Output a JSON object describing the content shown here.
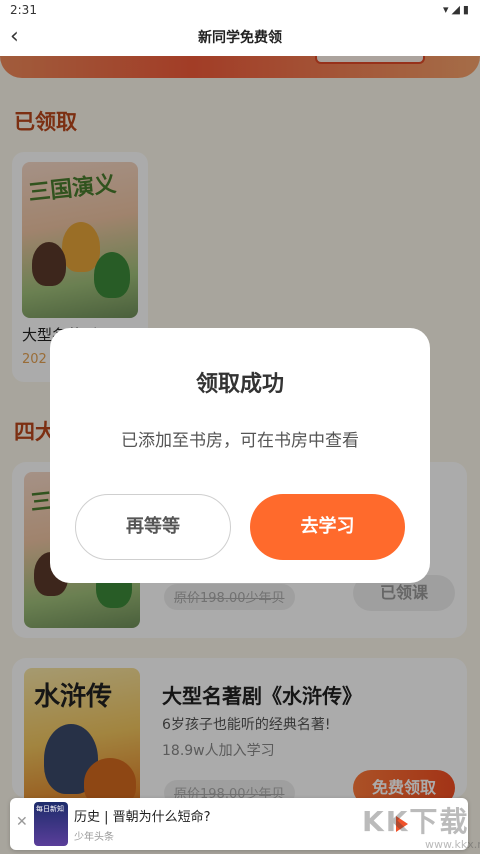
{
  "status_bar": {
    "time": "2:31",
    "icons": "▾◢▮"
  },
  "nav": {
    "back": "‹",
    "title": "新同学免费领"
  },
  "sections": {
    "claimed": "已领取",
    "classics": "四大"
  },
  "claimed_course": {
    "cover_title": "三国演义",
    "name": "大型名著剧",
    "date": "202"
  },
  "courses": [
    {
      "cover_title": "三国演义",
      "price": "原价198.00少年贝",
      "action": "已领课"
    },
    {
      "cover_title": "水浒传",
      "title": "大型名著剧《水浒传》",
      "desc": "6岁孩子也能听的经典名著!",
      "learners": "18.9w人加入学习",
      "price": "原价198.00少年贝",
      "action": "免费领取"
    }
  ],
  "dialog": {
    "title": "领取成功",
    "message": "已添加至书房，可在书房中查看",
    "cancel": "再等等",
    "confirm": "去学习"
  },
  "ad": {
    "close": "✕",
    "thumb_label": "每日新知",
    "title": "历史 | 晋朝为什么短命?",
    "source": "少年头条"
  },
  "watermark": {
    "text": "KK下载",
    "url": "www.kkx.net"
  }
}
